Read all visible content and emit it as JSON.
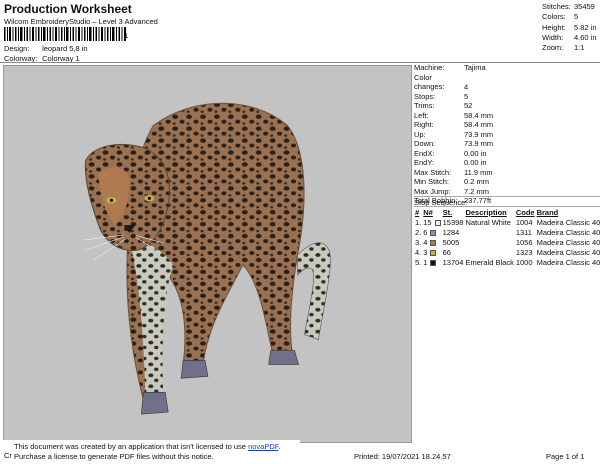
{
  "header": {
    "title": "Production Worksheet",
    "software": "Wilcom EmbroideryStudio – Level 3 Advanced",
    "barcode_number": "1",
    "design_label": "Design:",
    "design_value": "leopard 5,8 in",
    "colorway_label": "Colorway:",
    "colorway_value": "Colorway 1"
  },
  "top_stats": [
    {
      "label": "Stitches:",
      "value": "35459"
    },
    {
      "label": "Colors:",
      "value": "5"
    },
    {
      "label": "Height:",
      "value": "5.82 in"
    },
    {
      "label": "Width:",
      "value": "4.60 in"
    },
    {
      "label": "Zoom:",
      "value": "1:1"
    }
  ],
  "details": [
    {
      "label": "Machine:",
      "value": "Tajima"
    },
    {
      "label": "Color changes:",
      "value": "4"
    },
    {
      "label": "Stops:",
      "value": "5"
    },
    {
      "label": "Trims:",
      "value": "52"
    },
    {
      "label": "Left:",
      "value": "58.4 mm"
    },
    {
      "label": "Right:",
      "value": "58.4 mm"
    },
    {
      "label": "Up:",
      "value": "73.9 mm"
    },
    {
      "label": "Down:",
      "value": "73.9 mm"
    },
    {
      "label": "EndX:",
      "value": "0.00 in"
    },
    {
      "label": "EndY:",
      "value": "0.00 in"
    },
    {
      "label": "Max Stitch:",
      "value": "11.9 mm"
    },
    {
      "label": "Min Stitch:",
      "value": "0.2 mm"
    },
    {
      "label": "Max Jump:",
      "value": "7.2 mm"
    },
    {
      "label": "Total Bobbin:",
      "value": "237.77ft"
    }
  ],
  "stop_sequence": {
    "title": "Stop Sequence:",
    "headers": {
      "num": "#",
      "n": "N#",
      "st": "St.",
      "description": "Description",
      "code": "Code",
      "brand": "Brand"
    },
    "rows": [
      {
        "num": "1.",
        "n": "15",
        "color": "#f1efe6",
        "st": "15398",
        "description": "Natural White",
        "code": "1004",
        "brand": "Madeira Classic 40"
      },
      {
        "num": "2.",
        "n": "6",
        "color": "#8793b3",
        "st": "1284",
        "description": "",
        "code": "1311",
        "brand": "Madeira Classic 40"
      },
      {
        "num": "3.",
        "n": "4",
        "color": "#b2774a",
        "st": "5005",
        "description": "",
        "code": "1056",
        "brand": "Madeira Classic 40"
      },
      {
        "num": "4.",
        "n": "3",
        "color": "#c8ae44",
        "st": "66",
        "description": "",
        "code": "1323",
        "brand": "Madeira Classic 40"
      },
      {
        "num": "5.",
        "n": "1",
        "color": "#111111",
        "st": "13704",
        "description": "Emerald Black",
        "code": "1000",
        "brand": "Madeira Classic 40"
      }
    ]
  },
  "footer": {
    "notice_line1": "This document was created by an application that isn't licensed to use ",
    "notice_link": "novaPDF",
    "notice_end": ".",
    "notice_line2": "Purchase a license to generate PDF files without this notice.",
    "cr": "Cr",
    "printed": "Printed: 19/07/2021 18.24.57",
    "page": "Page 1 of 1"
  },
  "colors": {
    "canvas_bg": "#c3c3c3",
    "link": "#1a44c8"
  }
}
